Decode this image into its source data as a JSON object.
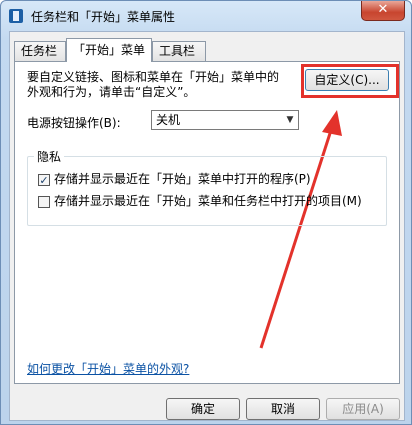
{
  "window": {
    "title": "任务栏和「开始」菜单属性",
    "close_label": "✕"
  },
  "tabs": [
    {
      "label": "任务栏"
    },
    {
      "label": "「开始」菜单"
    },
    {
      "label": "工具栏"
    }
  ],
  "customize": {
    "description_line1": "要自定义链接、图标和菜单在「开始」菜单中的",
    "description_line2": "外观和行为，请单击“自定义”。",
    "button_label": "自定义(C)..."
  },
  "power": {
    "label": "电源按钮操作(B):",
    "selected": "关机"
  },
  "privacy": {
    "title": "隐私",
    "items": [
      {
        "label": "存储并显示最近在「开始」菜单中打开的程序(P)",
        "checked": true
      },
      {
        "label": "存储并显示最近在「开始」菜单和任务栏中打开的项目(M)",
        "checked": false
      }
    ]
  },
  "help_link": "如何更改「开始」菜单的外观?",
  "footer": {
    "ok": "确定",
    "cancel": "取消",
    "apply": "应用(A)"
  },
  "colors": {
    "annotation_red": "#e3322b",
    "link_blue": "#0b52a4"
  },
  "icons": {
    "checked": "✓",
    "chevron": "▼"
  }
}
